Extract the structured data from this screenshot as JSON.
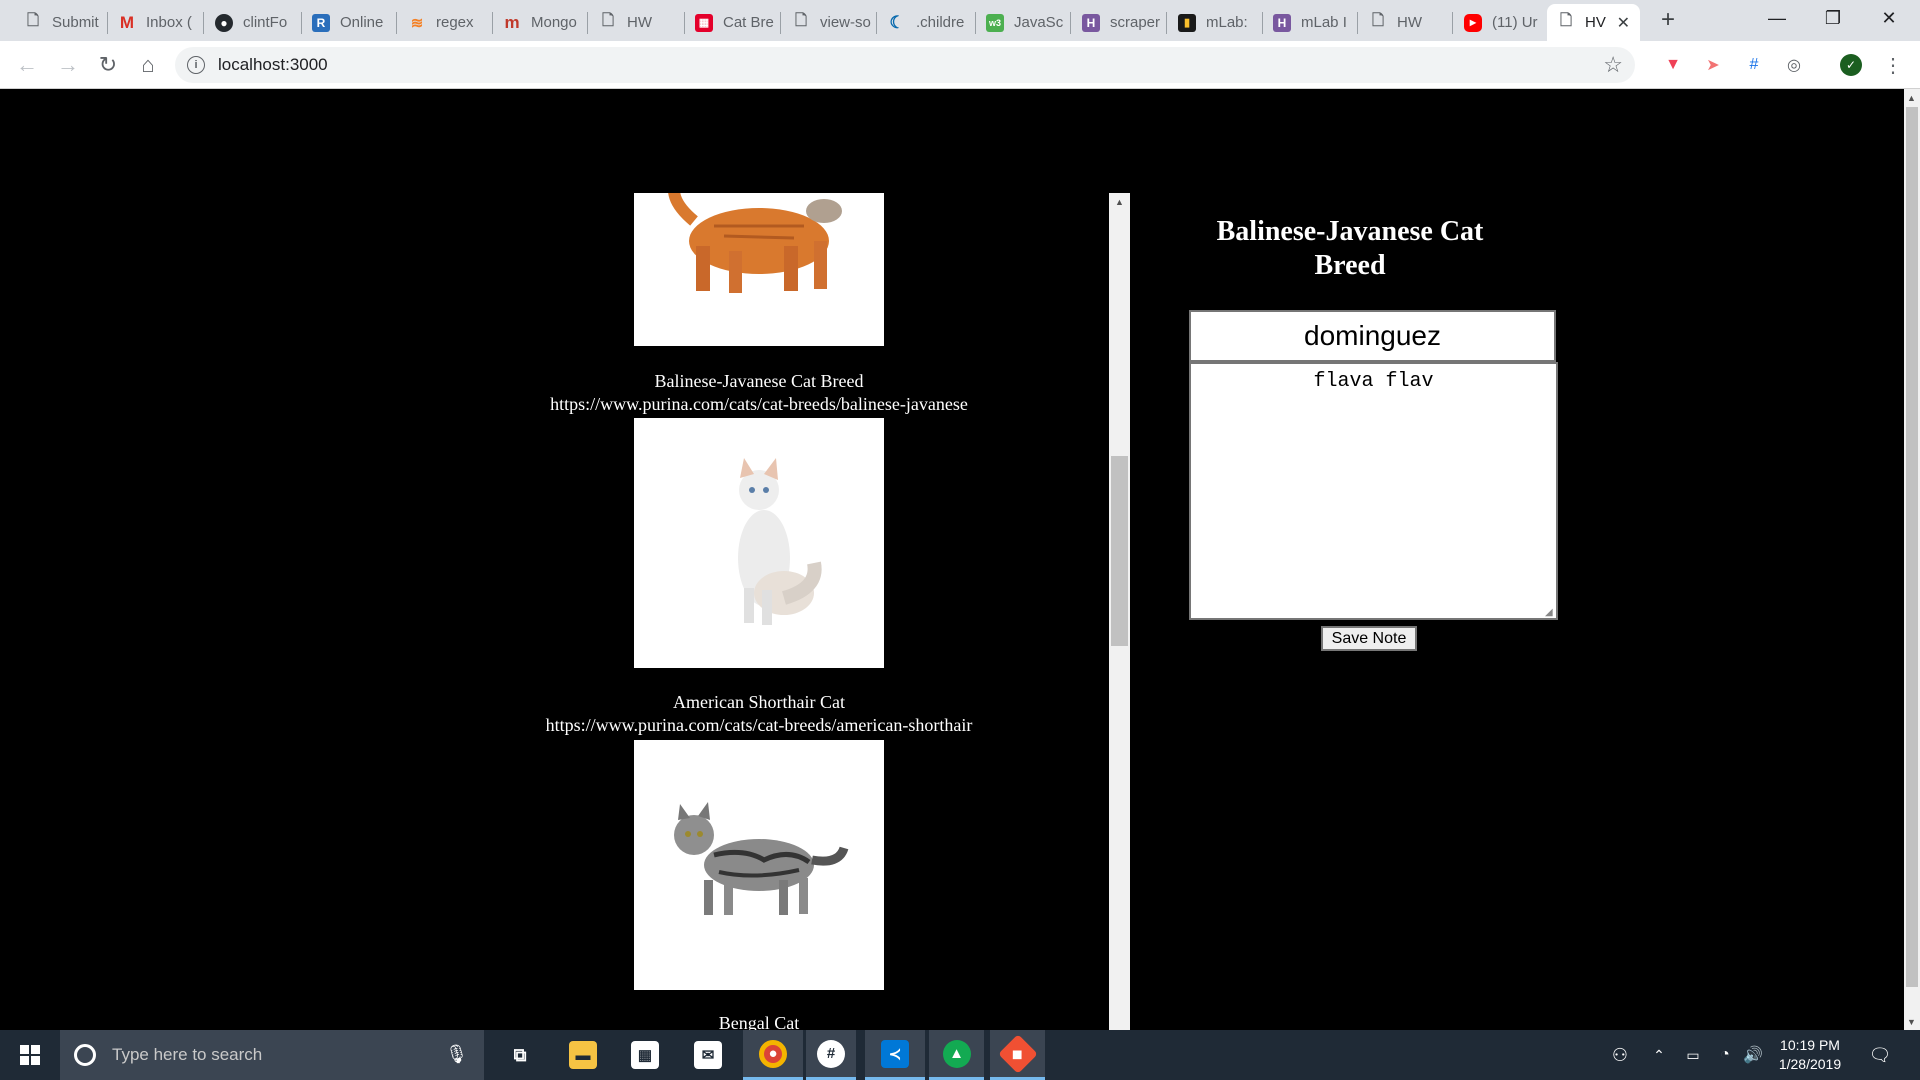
{
  "browser": {
    "tabs": [
      {
        "label": "Submit",
        "icon": "doc-icon"
      },
      {
        "label": "Inbox (",
        "icon": "gmail-icon"
      },
      {
        "label": "clintFo",
        "icon": "github-icon"
      },
      {
        "label": "Online",
        "icon": "r-icon"
      },
      {
        "label": "regex",
        "icon": "stack-icon"
      },
      {
        "label": "Mongo",
        "icon": "m-icon"
      },
      {
        "label": "HW",
        "icon": "doc-icon"
      },
      {
        "label": "Cat Bre",
        "icon": "purina-icon"
      },
      {
        "label": "view-so",
        "icon": "doc-icon"
      },
      {
        "label": ".childre",
        "icon": "jquery-icon"
      },
      {
        "label": "JavaSc",
        "icon": "w3-icon"
      },
      {
        "label": "scraper",
        "icon": "heroku-icon"
      },
      {
        "label": "mLab:",
        "icon": "mlab-icon"
      },
      {
        "label": "mLab I",
        "icon": "heroku-icon"
      },
      {
        "label": "HW",
        "icon": "doc-icon"
      },
      {
        "label": "(11) Ur",
        "icon": "youtube-icon"
      },
      {
        "label": "HV",
        "icon": "doc-icon",
        "active": true
      }
    ],
    "url": "localhost:3000"
  },
  "articles": [
    {
      "title": "",
      "link": ""
    },
    {
      "title": "Balinese-Javanese Cat Breed",
      "link": "https://www.purina.com/cats/cat-breeds/balinese-javanese"
    },
    {
      "title": "American Shorthair Cat",
      "link": "https://www.purina.com/cats/cat-breeds/american-shorthair"
    },
    {
      "title": "Bengal Cat",
      "link": ""
    }
  ],
  "note": {
    "heading": "Balinese-Javanese Cat Breed",
    "title_value": "dominguez",
    "body_value": "flava flav",
    "save_label": "Save Note"
  },
  "taskbar": {
    "search_placeholder": "Type here to search",
    "time": "10:19 PM",
    "date": "1/28/2019"
  },
  "colors": {
    "page_bg": "#000000",
    "taskbar_bg": "#1f2a36",
    "tabstrip_bg": "#dee1e6"
  }
}
